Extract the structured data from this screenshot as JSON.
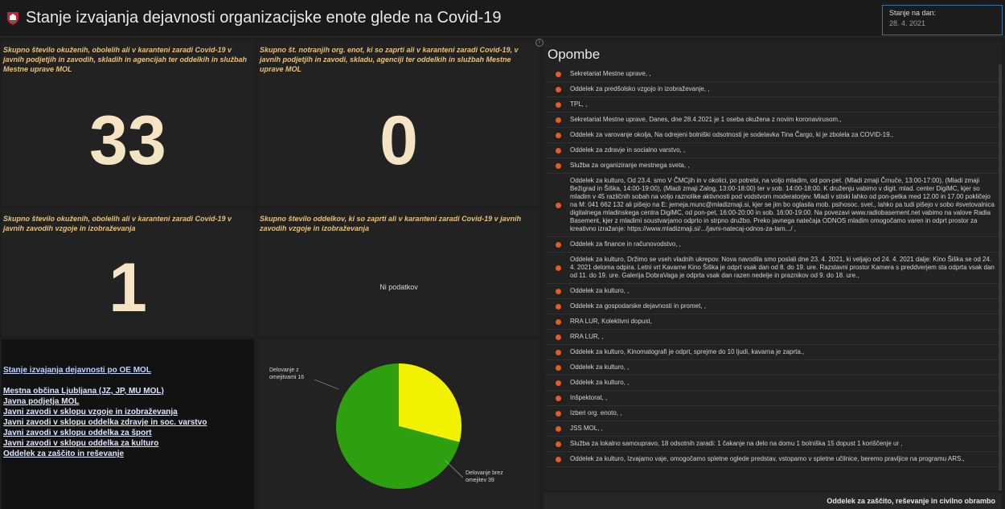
{
  "header": {
    "title": "Stanje izvajanja dejavnosti organizacijske enote glede na Covid-19",
    "date_label": "Stanje na dan:",
    "date_value": "28. 4. 2021"
  },
  "indicators": [
    {
      "title": "Skupno število okuženih, obolelih ali v karanteni zaradi Covid-19 v javnih podjetjih in zavodih, skladih in agencijah ter oddelkih in službah Mestne uprave MOL",
      "value": "33"
    },
    {
      "title": "Skupno št. notranjih org. enot, ki so zaprti ali v karanteni zaradi Covid-19, v javnih podjetjih in zavodi, skladu, agenciji ter oddelkih in službah Mestne uprave MOL",
      "value": "0"
    },
    {
      "title": "Skupno število okuženih, obolelih ali v karanteni zaradi Covid-19 v javnih zavodih vzgoje in izobraževanja",
      "value": "1"
    },
    {
      "title": "Skupno število oddelkov, ki so zaprti ali v karanteni zaradi Covid-19 v javnih zavodih vzgoje in izobraževanja",
      "no_data": "Ni podatkov"
    }
  ],
  "links": {
    "head": "Stanje izvajanja dejavnosti po OE MOL",
    "items": [
      "Mestna občina Ljubljana (JZ, JP, MU MOL)",
      "Javna podjetja MOL",
      "Javni zavodi v sklopu vzgoje in izobraževanja",
      "Javni zavodi v sklopu oddelka zdravje in soc. varstvo",
      "Javni zavodi v sklopu oddelka za šport",
      "Javni zavodi v sklopu oddelka za kulturo",
      "Oddelek za zaščito in reševanje"
    ]
  },
  "chart_data": {
    "type": "pie",
    "slices": [
      {
        "label": "Delovanje z omejitvami 16",
        "value": 16,
        "color": "#f2f200"
      },
      {
        "label": "Delovanje brez omejitev 39",
        "value": 39,
        "color": "#2ea00f"
      }
    ]
  },
  "notes": {
    "title": "Opombe",
    "items": [
      "Sekretariat Mestne uprave, ,",
      "Oddelek za predšolsko vzgojo in izobraževanje, ,",
      "TPL, ,",
      "Sekretariat Mestne uprave, Danes, dne 28.4.2021 je 1 oseba okužena z novim koronavirusom.,",
      "Oddelek za varovanje okolja, Na odrejeni bolniški odsotnosti je sodelavka Tina Čargo, ki je zbolela za COVID-19.,",
      "Oddelek za zdravje in socialno varstvo, ,",
      "Služba za organiziranje mestnega sveta, ,",
      "Oddelek za kulturo, Od 23.4. smo V ČMCjih in v okolici, po potrebi, na voljo mladim, od pon-pet. (Mladi zmaji Črnuče, 13:00-17:00), (Mladi zmaji Bežigrad in Šiška, 14:00-19:00), (Mladi zmaji Zalog, 13:00-18:00) ter v sob. 14:00-18:00. K druženju vabimo v digit. mlad. center DigiMC, kjer so mladim v 45 različnih sobah na voljo raznolike aktivnosti pod vodstvom moderatorjev. Mladi v stiski lahko od pon-petka med 12.00 in 17.00 pokličejo na M: 041 662 132 ali pišejo na E: jemeja.munc@mladizmaji.si, kjer se jim bo oglasila mob. psihosoc. svet., lahko pa tudi pišejo v sobo #svetovalnica digitalnega mladinskega centra DigiMC, od pon-pet, 16:00-20:00 in sob. 16:00-19:00. Na povezavi www.radiobasement.net vabimo na valove Radia Basement, kjer z mladimi soustvarjamo odprto in strpno družbo. Preko javnega natečaja ODNOS mladim omogočamo varen in odprt prostor za kreativno izražanje: https://www.mladizmaji.si/.../javni-natecaj-odnos-za-tam.../ ,",
      "Oddelek za finance in računovodstvo, ,",
      "Oddelek za kulturo, Držimo se vseh vladnih ukrepov. Nova navodila smo poslali dne 23. 4. 2021, ki veljajo od 24. 4. 2021 dalje: Kino Šiška se od 24. 4. 2021 deloma odpira. Letni vrt Kavarne Kino Šiška je odprt vsak dan od 8. do 19. ure. Razstavni prostor Kamera s preddverjem sta odprta vsak dan od 11. do 19. ure. Galerija DobraVaga je odprta vsak dan razen nedelje in praznikov od 9. do 18. ure.,",
      "Oddelek za kulturo, ,",
      "Oddelek za gospodarske dejavnosti in promet, ,",
      "RRA LUR, Kolektivni dopust,",
      "RRA LUR, ,",
      "Oddelek za kulturo, Kinomatografi je odprt, sprejme do 10 ljudi, kavarna je zaprta.,",
      "Oddelek za kulturo, ,",
      "Oddelek za kulturo, ,",
      "Inšpektorat, ,",
      "Izberi org. enoto, ,",
      "JSS MOL, ,",
      "Služba za lokalno samoupravo, 18 odsotnih zaradi: 1 čakanje na delo na domu 1 bolniška 15 dopust 1 koriščenje ur ,",
      "Oddelek za kulturo, Izvajamo vaje, omogočamo spletne oglede predstav, vstopamo v spletne učilnice, beremo pravljice na programu ARS.,"
    ]
  },
  "footer": {
    "text": "Oddelek za zaščito, reševanje in civilno obrambo"
  },
  "colors": {
    "indicator_title": "#e6c27f",
    "indicator_value": "#f5e4c4",
    "bullet": "#e85b1b",
    "background": "#1e1e1e"
  }
}
